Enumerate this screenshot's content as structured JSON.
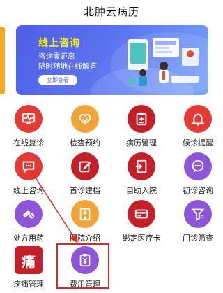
{
  "header": {
    "title": "北肿云病历"
  },
  "banner": {
    "title": "线上咨询",
    "line1": "咨询零距离",
    "line2": "随时随地在线解答",
    "button": "立即查看"
  },
  "grid": {
    "items": [
      {
        "label": "在线复诊",
        "icon": "monitor-heart-icon",
        "color": "#e13b35"
      },
      {
        "label": "检查预约",
        "icon": "heart-hand-icon",
        "color": "#f0a43a"
      },
      {
        "label": "病历管理",
        "icon": "clipboard-plus-icon",
        "color": "#c4202a"
      },
      {
        "label": "候诊提醒",
        "icon": "bell-icon",
        "color": "#8f55d9"
      },
      {
        "label": "线上咨询",
        "icon": "chat-bubble-icon",
        "color": "#e13b35"
      },
      {
        "label": "首诊建档",
        "icon": "edit-document-icon",
        "color": "#c4202a"
      },
      {
        "label": "自助入院",
        "icon": "hospital-entry-icon",
        "color": "#c4202a"
      },
      {
        "label": "初诊咨询",
        "icon": "chat-dots-icon",
        "color": "#8f55d9"
      },
      {
        "label": "处方用药",
        "icon": "pills-icon",
        "color": "#8f55d9"
      },
      {
        "label": "医院介绍",
        "icon": "hospital-building-icon",
        "color": "#f0a43a"
      },
      {
        "label": "绑定医疗卡",
        "icon": "card-icon",
        "color": "#c4202a"
      },
      {
        "label": "门诊筛查",
        "icon": "filter-icon",
        "color": "#8f55d9"
      },
      {
        "label": "疼痛管理",
        "icon": "pain-character-icon",
        "icon_text": "痛",
        "color": "#c4202a"
      },
      {
        "label": "费用管理",
        "icon": "yen-clipboard-icon",
        "color": "#8f55d9"
      }
    ]
  },
  "colors": {
    "accent_red": "#d8262f",
    "orange_tab": "#f5a623",
    "banner_blue": "#4f5ee6"
  }
}
